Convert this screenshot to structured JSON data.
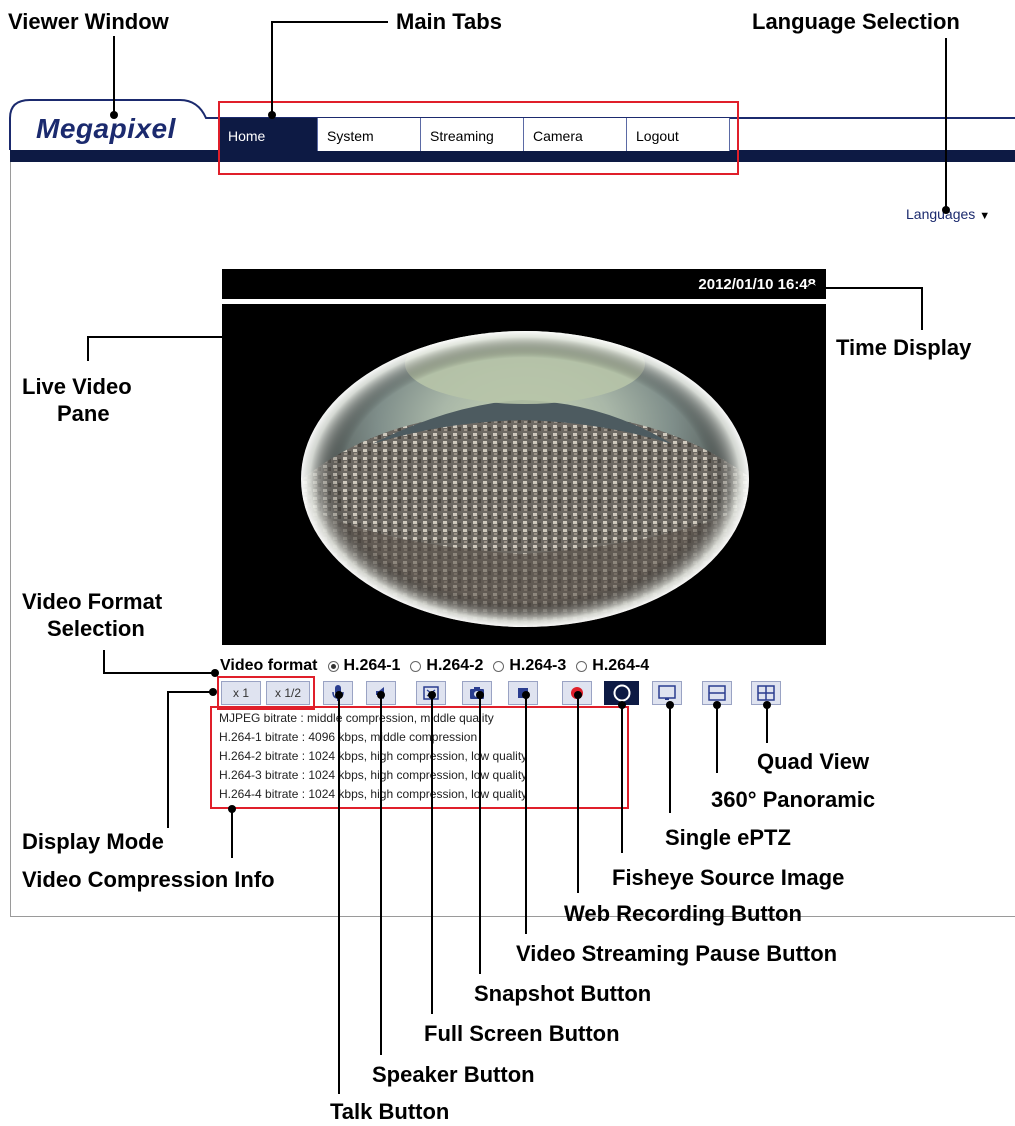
{
  "callouts": {
    "viewer_window": "Viewer Window",
    "main_tabs": "Main Tabs",
    "language_selection": "Language Selection",
    "time_display": "Time Display",
    "live_video_pane_1": "Live Video",
    "live_video_pane_2": "Pane",
    "video_format_selection_1": "Video Format",
    "video_format_selection_2": "Selection",
    "quad_view": "Quad View",
    "panoramic_360": "360° Panoramic",
    "single_eptz": "Single ePTZ",
    "display_mode": "Display Mode",
    "video_compression_info": "Video Compression Info",
    "fisheye_source_image": "Fisheye Source Image",
    "web_recording_button": "Web Recording Button",
    "video_streaming_pause_button": "Video Streaming Pause Button",
    "snapshot_button": "Snapshot Button",
    "full_screen_button": "Full Screen Button",
    "speaker_button": "Speaker Button",
    "talk_button": "Talk Button"
  },
  "app": {
    "logo": "Megapixel",
    "tabs": [
      "Home",
      "System",
      "Streaming",
      "Camera",
      "Logout"
    ],
    "languages_label": "Languages",
    "timestamp": "2012/01/10 16:48"
  },
  "video_format": {
    "label": "Video format",
    "options": [
      "H.264-1",
      "H.264-2",
      "H.264-3",
      "H.264-4"
    ],
    "selected": "H.264-1"
  },
  "display_mode": {
    "x1": "x 1",
    "x_half": "x 1/2"
  },
  "toolbar_icons": [
    "talk-icon",
    "speaker-icon",
    "full-screen-icon",
    "snapshot-icon",
    "pause-icon",
    "record-icon",
    "fisheye-source-icon",
    "single-eptz-icon",
    "panoramic-icon",
    "quad-view-icon"
  ],
  "compression_info": [
    "MJPEG bitrate : middle compression, middle quality",
    "H.264-1 bitrate : 4096 kbps, middle compression",
    "H.264-2 bitrate : 1024 kbps, high compression, low quality",
    "H.264-3 bitrate : 1024 kbps, high compression, low quality",
    "H.264-4 bitrate : 1024 kbps, high compression, low quality"
  ],
  "colors": {
    "navy": "#0d1a44",
    "highlight_red": "#e01f2a",
    "record_red": "#e01f2a"
  }
}
